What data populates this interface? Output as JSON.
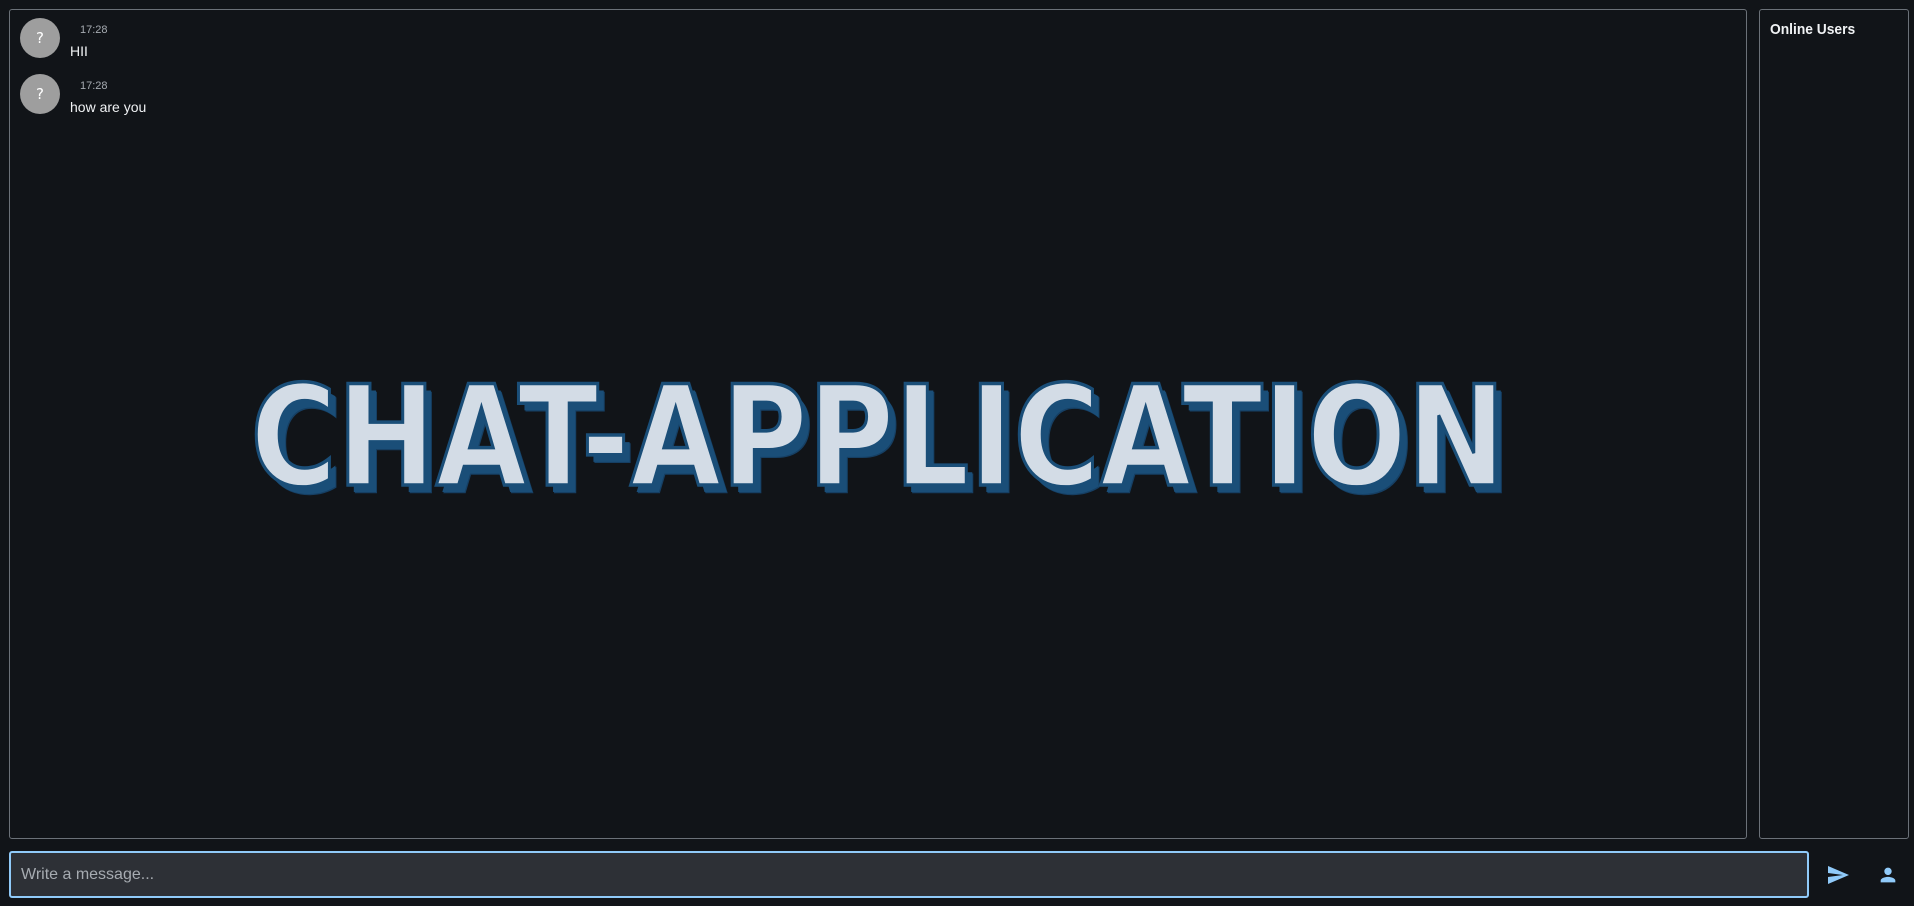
{
  "chat": {
    "messages": [
      {
        "avatar": "?",
        "time": "17:28",
        "text": "HII"
      },
      {
        "avatar": "?",
        "time": "17:28",
        "text": "how are you"
      }
    ],
    "watermark": "CHAT-APPLICATION"
  },
  "sidebar": {
    "title": "Online Users"
  },
  "composer": {
    "placeholder": "Write a message..."
  },
  "icons": {
    "send": "send-icon",
    "user": "person-icon"
  },
  "colors": {
    "background": "#111418",
    "panel_border": "#6b7178",
    "input_background": "#2d3036",
    "input_focus_border": "#90caf9",
    "icon_accent": "#90caf9",
    "watermark_fill": "#d3dce6",
    "watermark_outline": "#1a4e78"
  }
}
